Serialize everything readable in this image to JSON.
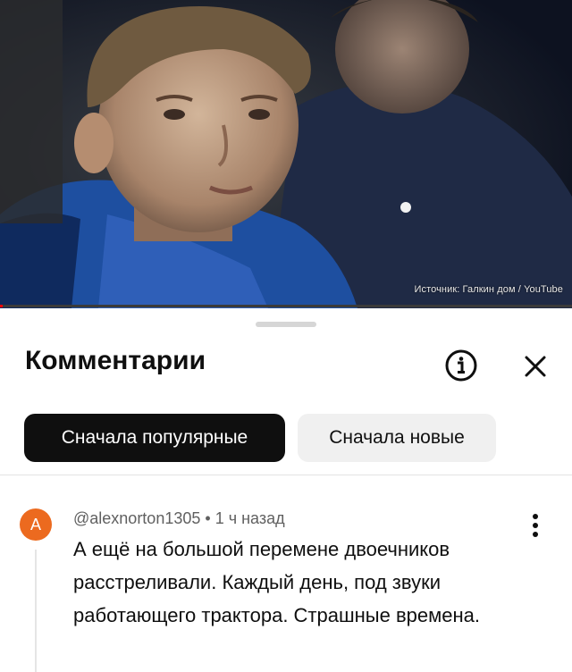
{
  "video": {
    "caption": "Источник: Галкин дом / YouTube",
    "progress_fraction": 0.004,
    "progress_color": "#ff0000"
  },
  "comments_panel": {
    "title": "Комментарии",
    "info_icon": "info-icon",
    "close_icon": "close-icon",
    "chips": [
      {
        "label": "Сначала популярные",
        "active": true
      },
      {
        "label": "Сначала новые",
        "active": false
      }
    ]
  },
  "comment": {
    "avatar_letter": "A",
    "avatar_color": "#ec6a1f",
    "author": "@alexnorton1305",
    "separator": "•",
    "time": "1 ч назад",
    "text": "А ещё на большой перемене двоечников расстреливали. Каждый день, под звуки работающего трактора. Страшные времена.",
    "more_icon": "more-vert-icon"
  }
}
